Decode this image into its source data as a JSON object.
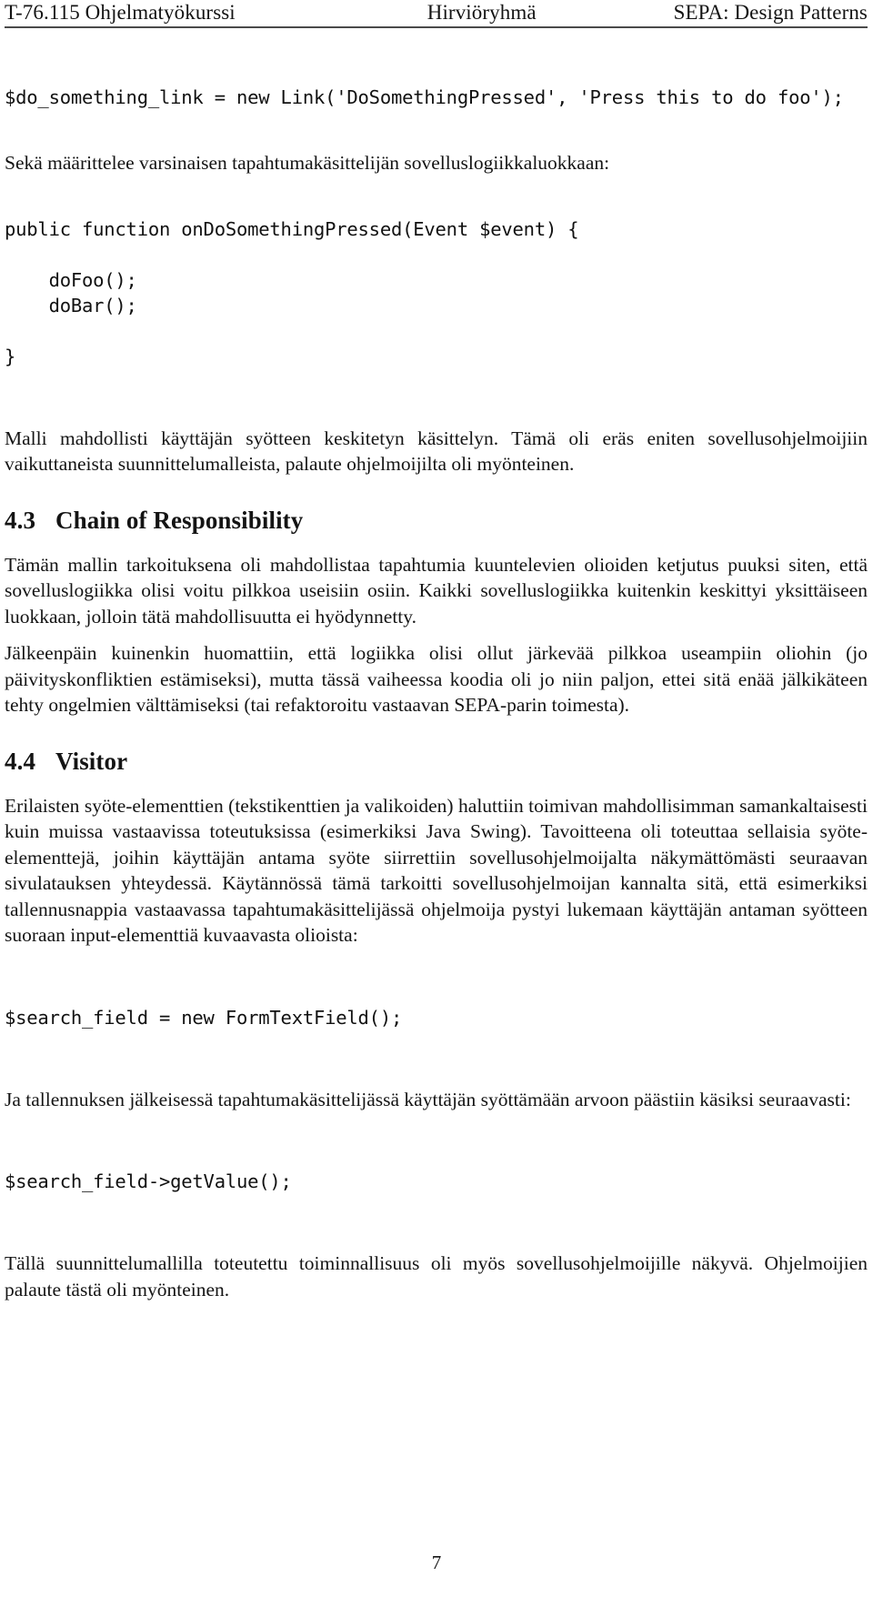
{
  "header": {
    "left": "T-76.115 Ohjelmatyökurssi",
    "center": "Hirviöryhmä",
    "right": "SEPA: Design Patterns"
  },
  "content": {
    "code_link": "$do_something_link = new Link('DoSomethingPressed', 'Press this to do foo');",
    "para_handler_intro": "Sekä määrittelee varsinaisen tapahtumakäsittelijän sovelluslogiikkaluokkaan:",
    "code_handler": "public function onDoSomethingPressed(Event $event) {\n\n    doFoo();\n    doBar();\n\n}",
    "para_malli": "Malli mahdollisti käyttäjän syötteen keskitetyn käsittelyn. Tämä oli eräs eniten sovellusohjelmoijiin vaikuttaneista suunnittelumalleista, palaute ohjelmoijilta oli myönteinen.",
    "section_43": {
      "number": "4.3",
      "title": "Chain of Responsibility",
      "para_1": "Tämän mallin tarkoituksena oli mahdollistaa tapahtumia kuuntelevien olioiden ketjutus puuksi siten, että sovelluslogiikka olisi voitu pilkkoa useisiin osiin. Kaikki sovelluslogiikka kuitenkin keskittyi yksittäiseen luokkaan, jolloin tätä mahdollisuutta ei hyödynnetty.",
      "para_2": "Jälkeenpäin kuinenkin huomattiin, että logiikka olisi ollut järkevää pilkkoa useampiin oliohin (jo päivityskonfliktien estämiseksi), mutta tässä vaiheessa koodia oli jo niin paljon, ettei sitä enää jälkikäteen tehty ongelmien välttämiseksi (tai refaktoroitu vastaavan SEPA-parin toimesta)."
    },
    "section_44": {
      "number": "4.4",
      "title": "Visitor",
      "para_1": "Erilaisten syöte-elementtien (tekstikenttien ja valikoiden) haluttiin toimivan mahdollisimman samankaltaisesti kuin muissa vastaavissa toteutuksissa (esimerkiksi Java Swing). Tavoitteena oli toteuttaa sellaisia syöte-elementtejä, joihin käyttäjän antama syöte siirrettiin sovellusohjelmoijalta näkymättömästi seuraavan sivulatauksen yhteydessä. Käytännössä tämä tarkoitti sovellusohjelmoijan kannalta sitä, että esimerkiksi tallennusnappia vastaavassa tapahtumakäsittelijässä ohjelmoija pystyi lukemaan käyttäjän antaman syötteen suoraan input-elementtiä kuvaavasta olioista:",
      "code_1": "$search_field = new FormTextField();",
      "para_2": "Ja tallennuksen jälkeisessä tapahtumakäsittelijässä käyttäjän syöttämään arvoon päästiin käsiksi seuraavasti:",
      "code_2": "$search_field->getValue();",
      "para_3": "Tällä suunnittelumallilla toteutettu toiminnallisuus oli myös sovellusohjelmoijille näkyvä. Ohjelmoijien palaute tästä oli myönteinen."
    }
  },
  "footer": {
    "page_number": "7"
  }
}
